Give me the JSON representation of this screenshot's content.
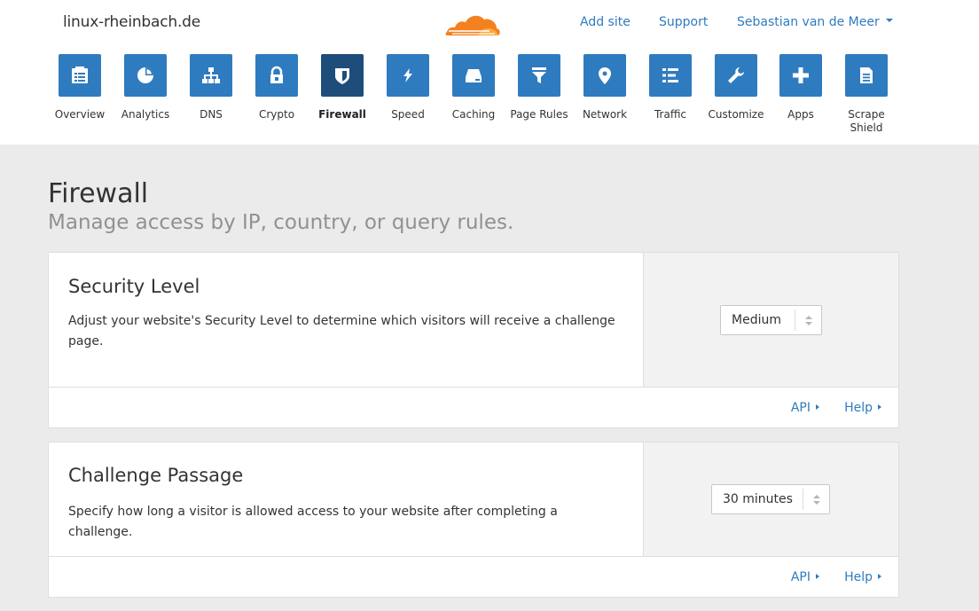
{
  "header": {
    "site": "linux-rheinbach.de",
    "add_site": "Add site",
    "support": "Support",
    "user": "Sebastian van de Meer"
  },
  "apps": [
    {
      "label": "Overview",
      "icon": "clipboard-icon"
    },
    {
      "label": "Analytics",
      "icon": "pie-chart-icon"
    },
    {
      "label": "DNS",
      "icon": "network-tree-icon"
    },
    {
      "label": "Crypto",
      "icon": "lock-icon"
    },
    {
      "label": "Firewall",
      "icon": "shield-icon",
      "active": true
    },
    {
      "label": "Speed",
      "icon": "lightning-icon"
    },
    {
      "label": "Caching",
      "icon": "hard-drive-icon"
    },
    {
      "label": "Page Rules",
      "icon": "filter-icon"
    },
    {
      "label": "Network",
      "icon": "map-pin-icon"
    },
    {
      "label": "Traffic",
      "icon": "list-icon"
    },
    {
      "label": "Customize",
      "icon": "wrench-icon"
    },
    {
      "label": "Apps",
      "icon": "plus-icon"
    },
    {
      "label": "Scrape Shield",
      "icon": "document-icon"
    }
  ],
  "page": {
    "title": "Firewall",
    "subtitle": "Manage access by IP, country, or query rules."
  },
  "cards": [
    {
      "title": "Security Level",
      "description": "Adjust your website's Security Level to determine which visitors will receive a challenge page.",
      "select_value": "Medium",
      "api": "API",
      "help": "Help"
    },
    {
      "title": "Challenge Passage",
      "description": "Specify how long a visitor is allowed access to your website after completing a challenge.",
      "select_value": "30 minutes",
      "api": "API",
      "help": "Help"
    }
  ],
  "colors": {
    "accent": "#2f7bbf",
    "active_tile": "#1e4d7b",
    "logo_orange": "#f48120",
    "logo_light": "#faad3f"
  }
}
